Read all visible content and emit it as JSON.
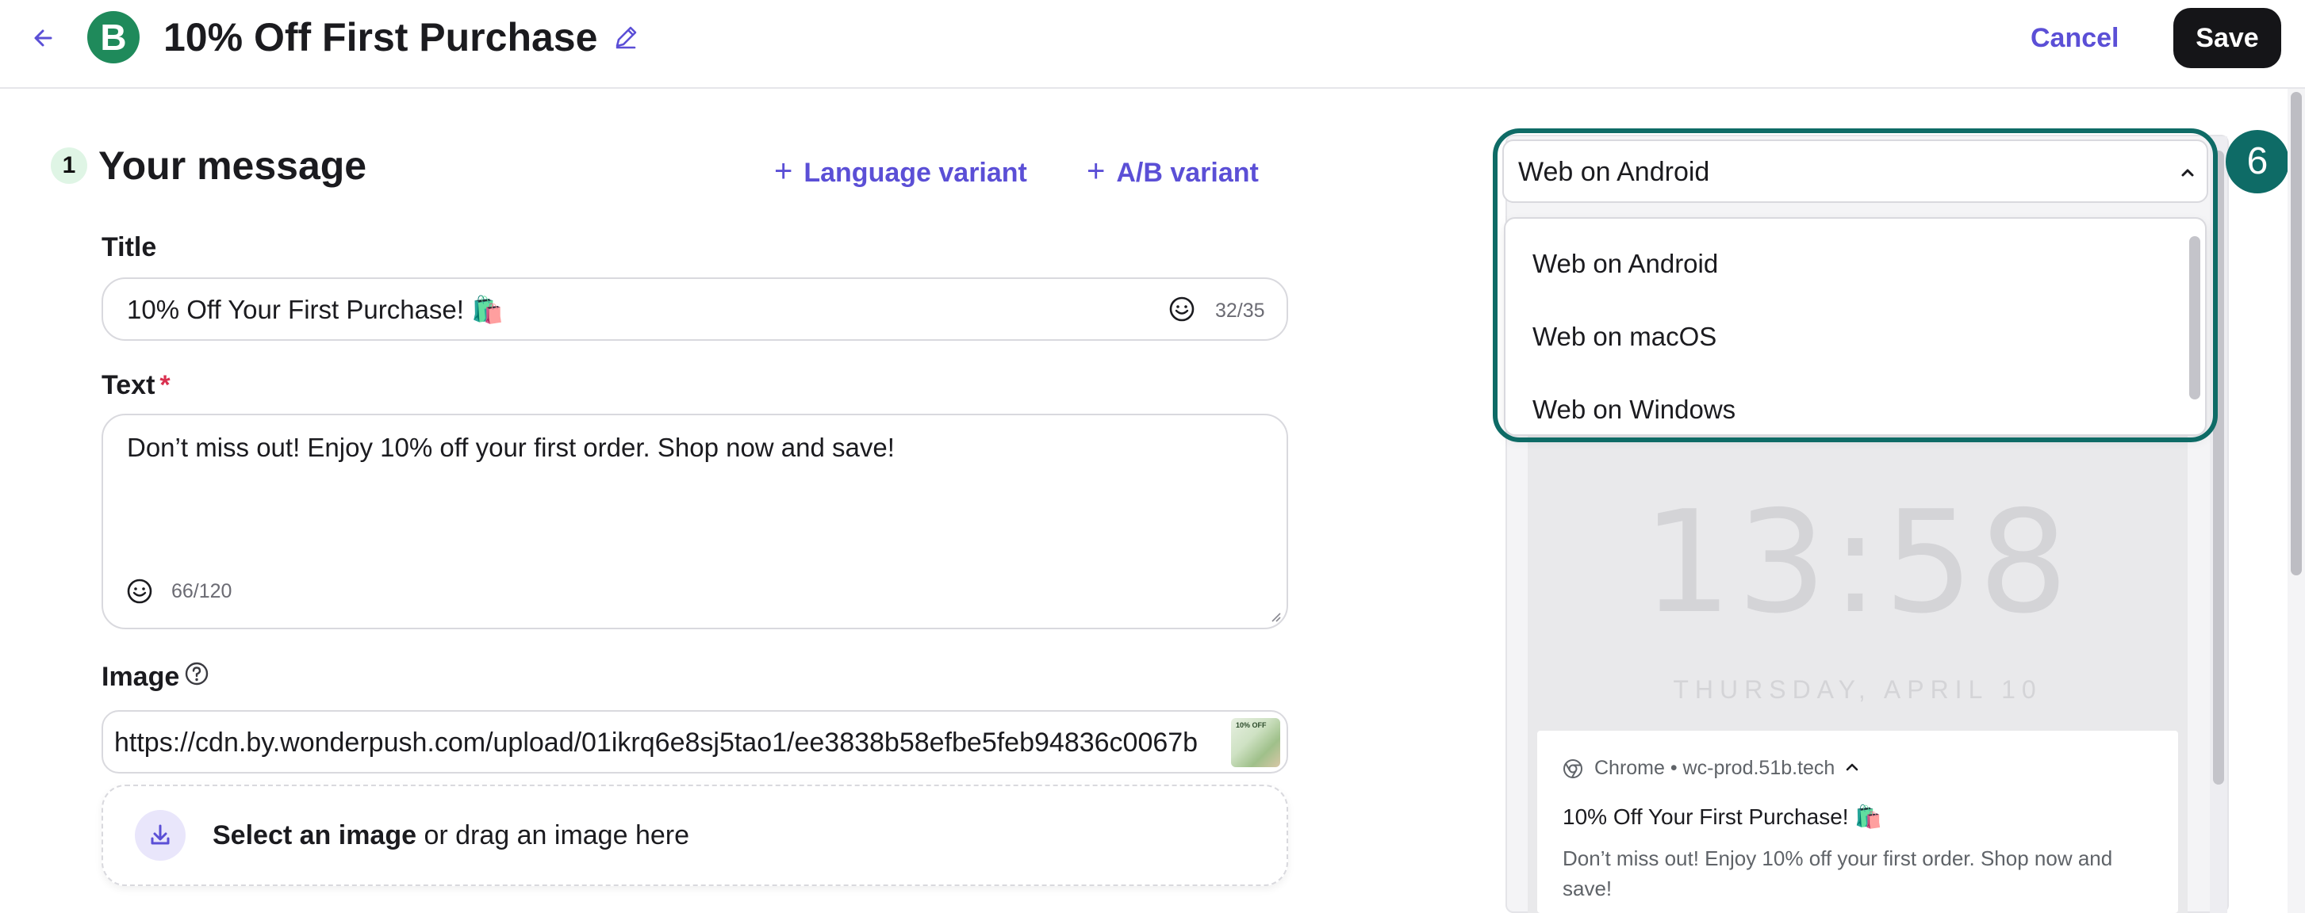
{
  "header": {
    "logo_letter": "B",
    "title": "10% Off First Purchase",
    "cancel_label": "Cancel",
    "save_label": "Save"
  },
  "form": {
    "step_number": "1",
    "section_title": "Your message",
    "language_variant_label": "Language variant",
    "ab_variant_label": "A/B variant",
    "title_label": "Title",
    "title_value": "10% Off Your First Purchase! 🛍️",
    "title_counter": "32/35",
    "text_label": "Text",
    "text_required_mark": "*",
    "text_value": "Don’t miss out! Enjoy 10% off your first order. Shop now and save!",
    "text_counter": "66/120",
    "image_label": "Image",
    "image_url": "https://cdn.by.wonderpush.com/upload/01ikrq6e8sj5tao1/ee3838b58efbe5feb94836c0067b",
    "image_thumb_text": "10% OFF",
    "dropzone_bold": "Select an image",
    "dropzone_rest": " or drag an image here"
  },
  "preview": {
    "platform_selected": "Web on Android",
    "platform_options": [
      "Web on Android",
      "Web on macOS",
      "Web on Windows"
    ],
    "step_marker": "6",
    "clock": "13:58",
    "date": "THURSDAY, APRIL 10",
    "notification": {
      "meta": "Chrome • wc-prod.51b.tech",
      "title": "10% Off Your First Purchase! 🛍️",
      "body": "Don’t miss out! Enjoy 10% off your first order. Shop now and save!"
    }
  },
  "colors": {
    "accent": "#5b4fd6",
    "brand_green": "#1f8a5b",
    "highlight": "#0e6b66",
    "save_bg": "#151518"
  },
  "icons": [
    "back-arrow-icon",
    "pencil-icon",
    "plus-icon",
    "smile-icon",
    "help-circle-icon",
    "download-icon",
    "chevron-up-icon",
    "chrome-icon"
  ]
}
